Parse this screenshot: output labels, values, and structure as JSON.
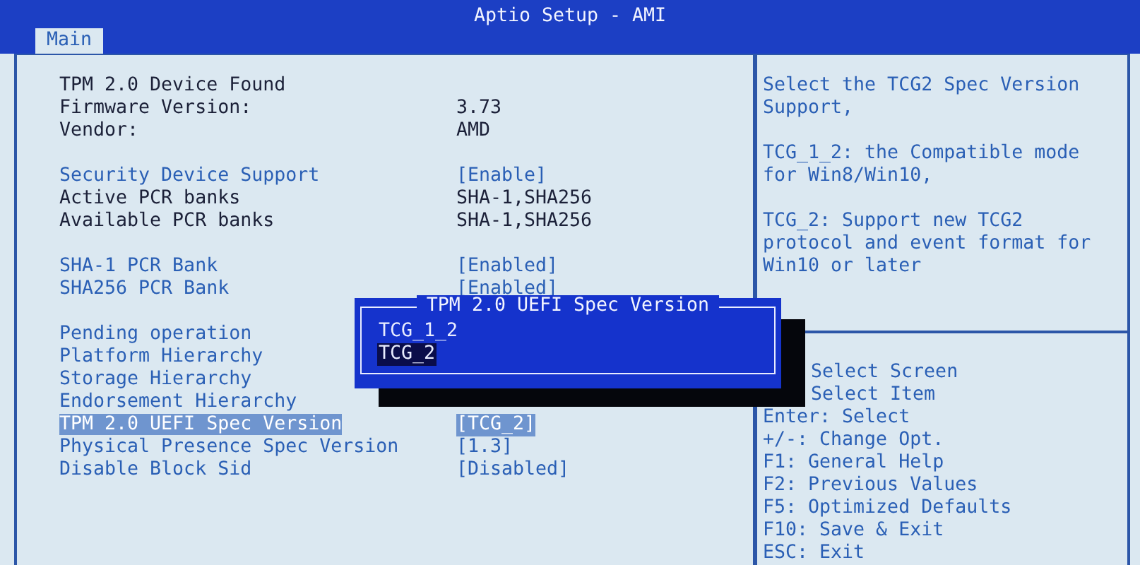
{
  "window": {
    "title": "Aptio Setup - AMI"
  },
  "tabs": [
    {
      "label": "Main",
      "selected": true
    }
  ],
  "groups": [
    {
      "rows": [
        {
          "kind": "info",
          "label": "TPM 2.0 Device Found",
          "selected": false
        },
        {
          "kind": "info",
          "label": "Firmware Version:",
          "value": "3.73",
          "selected": false
        },
        {
          "kind": "info",
          "label": "Vendor:",
          "value": "AMD",
          "selected": false
        }
      ]
    },
    {
      "rows": [
        {
          "kind": "setting",
          "label": "Security Device Support",
          "value": "[Enable]",
          "selected": false
        },
        {
          "kind": "info",
          "label": "Active PCR banks",
          "value": "SHA-1,SHA256",
          "selected": false
        },
        {
          "kind": "info",
          "label": "Available PCR banks",
          "value": "SHA-1,SHA256",
          "selected": false
        }
      ]
    },
    {
      "rows": [
        {
          "kind": "setting",
          "label": "SHA-1 PCR Bank",
          "value": "[Enabled]",
          "selected": false
        },
        {
          "kind": "setting",
          "label": "SHA256 PCR Bank",
          "value": "[Enabled]",
          "selected": false
        }
      ]
    },
    {
      "rows": [
        {
          "kind": "setting",
          "label": "Pending operation",
          "selected": false
        },
        {
          "kind": "setting",
          "label": "Platform Hierarchy",
          "selected": false
        },
        {
          "kind": "setting",
          "label": "Storage Hierarchy",
          "selected": false
        },
        {
          "kind": "setting",
          "label": "Endorsement Hierarchy",
          "selected": false
        },
        {
          "kind": "setting",
          "label": "TPM 2.0 UEFI Spec Version",
          "value": "[TCG_2]",
          "selected": true
        },
        {
          "kind": "setting",
          "label": "Physical Presence Spec Version",
          "value": "[1.3]",
          "selected": false
        },
        {
          "kind": "setting",
          "label": "Disable Block Sid",
          "value": "[Disabled]",
          "selected": false
        }
      ]
    }
  ],
  "help": [
    "Select the TCG2 Spec Version Support,",
    "TCG_1_2: the Compatible mode for Win8/Win10,",
    "TCG_2: Support new TCG2 protocol and event format for Win10 or later"
  ],
  "keys": [
    {
      "text": "Select Screen",
      "obscured": true
    },
    {
      "text": "Select Item",
      "obscured": true
    },
    {
      "text": "Enter: Select",
      "obscured": false
    },
    {
      "text": "+/-: Change Opt.",
      "obscured": false
    },
    {
      "text": "F1: General Help",
      "obscured": false
    },
    {
      "text": "F2: Previous Values",
      "obscured": false
    },
    {
      "text": "F5: Optimized Defaults",
      "obscured": false
    },
    {
      "text": "F10: Save & Exit",
      "obscured": false
    },
    {
      "text": "ESC: Exit",
      "obscured": false
    }
  ],
  "popup": {
    "title": "TPM 2.0 UEFI Spec Version",
    "options": [
      {
        "label": "TCG_1_2",
        "selected": false
      },
      {
        "label": "TCG_2",
        "selected": true
      }
    ]
  }
}
